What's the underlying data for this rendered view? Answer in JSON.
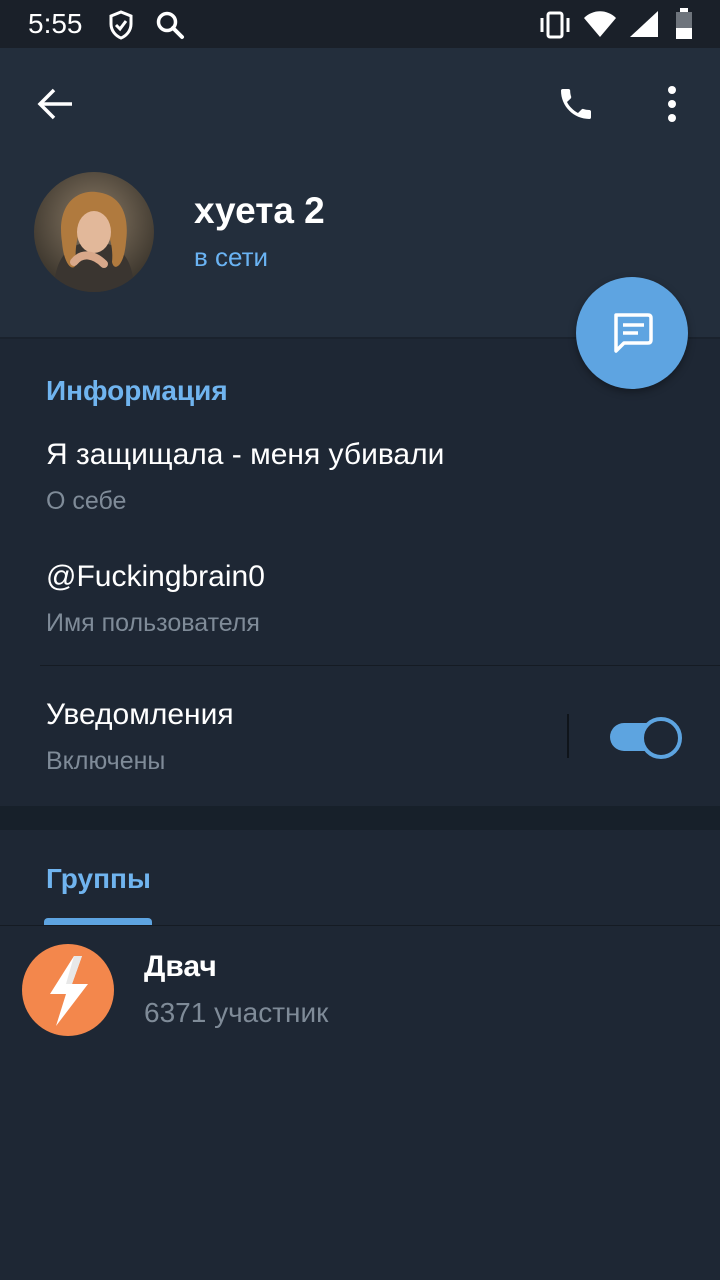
{
  "status_bar": {
    "time": "5:55"
  },
  "header": {
    "name": "хуета 2",
    "status": "в сети"
  },
  "info": {
    "section_title": "Информация",
    "bio": "Я защищала - меня убивали",
    "bio_label": "О себе",
    "username": "@Fuckingbrain0",
    "username_label": "Имя пользователя",
    "notifications": "Уведомления",
    "notifications_state": "Включены",
    "notifications_enabled": true
  },
  "groups": {
    "tab_label": "Группы",
    "items": [
      {
        "name": "Двач",
        "members": "6371 участник"
      }
    ]
  },
  "colors": {
    "accent": "#5ea4e1",
    "header_bg": "#232e3c",
    "body_bg": "#1e2734",
    "group_icon": "#f3874c"
  },
  "icons": {
    "status": [
      "shield-icon",
      "search-icon",
      "vibrate-icon",
      "wifi-icon",
      "signal-icon",
      "battery-icon"
    ],
    "header": [
      "back-arrow-icon",
      "phone-icon",
      "more-vertical-icon"
    ],
    "fab": "message-icon",
    "group": "lightning-icon"
  }
}
